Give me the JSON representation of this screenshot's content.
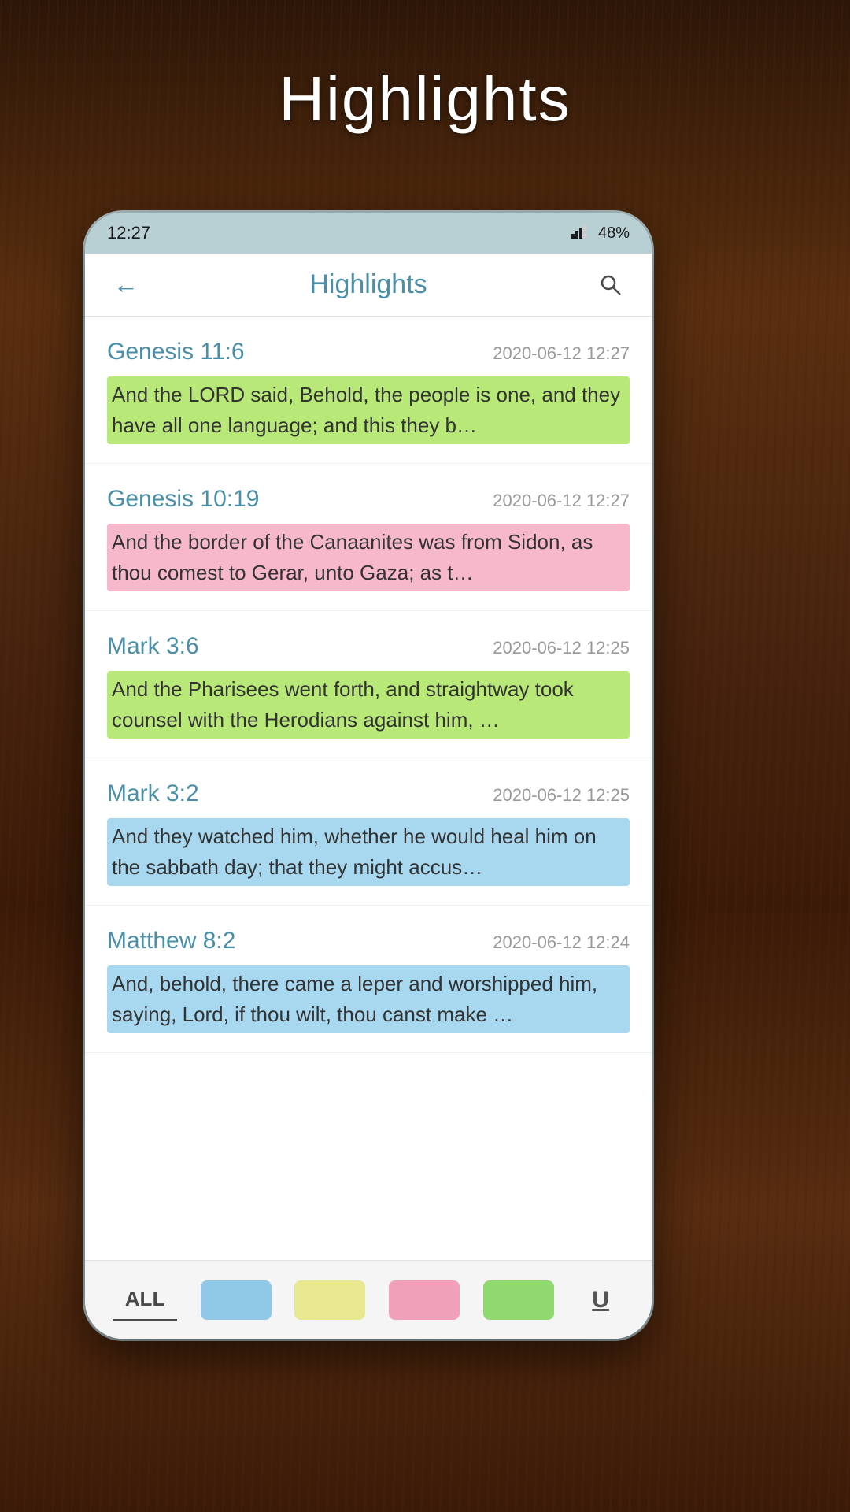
{
  "page": {
    "title": "Highlights",
    "background_color": "#3a2010"
  },
  "status_bar": {
    "time": "12:27",
    "battery": "48%",
    "icons": "▲ 📷"
  },
  "header": {
    "title": "Highlights",
    "back_label": "←",
    "search_label": "🔍"
  },
  "highlights": [
    {
      "reference": "Genesis 11:6",
      "date": "2020-06-12 12:27",
      "text": "And the LORD said, Behold, the people is one, and they have all one language; and this they b…",
      "highlight_color": "green"
    },
    {
      "reference": "Genesis 10:19",
      "date": "2020-06-12 12:27",
      "text": "And the border of the Canaanites was from Sidon, as thou comest to Gerar, unto Gaza; as t…",
      "highlight_color": "pink"
    },
    {
      "reference": "Mark 3:6",
      "date": "2020-06-12 12:25",
      "text": "And the Pharisees went forth, and straightway took counsel with the Herodians against him, …",
      "highlight_color": "green"
    },
    {
      "reference": "Mark 3:2",
      "date": "2020-06-12 12:25",
      "text": "And they watched him, whether he would heal him on the sabbath day; that they might accus…",
      "highlight_color": "blue"
    },
    {
      "reference": "Matthew 8:2",
      "date": "2020-06-12 12:24",
      "text": "And, behold, there came a leper and worshipped him, saying, Lord, if thou wilt, thou canst make …",
      "highlight_color": "blue"
    }
  ],
  "bottom_bar": {
    "tab_all": "ALL",
    "tab_underline": "U",
    "colors": [
      "blue",
      "yellow",
      "pink",
      "green"
    ]
  }
}
